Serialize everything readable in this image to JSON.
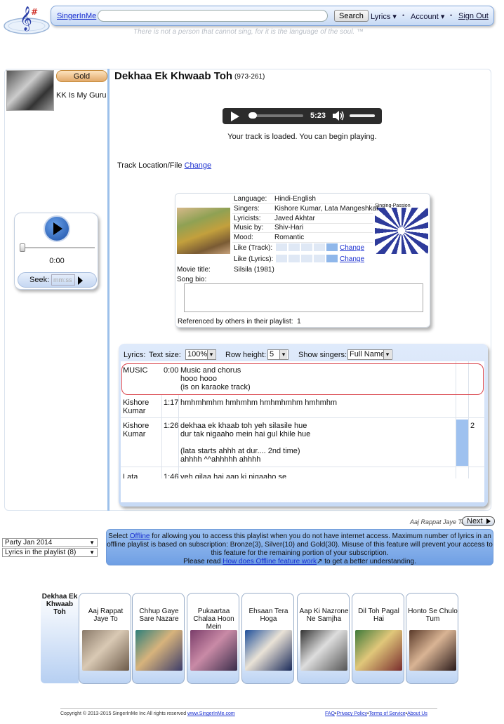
{
  "header": {
    "brand_link": "SingerInMe",
    "search_button": "Search",
    "menu_lyrics": "Lyrics",
    "menu_account": "Account",
    "sign_out": "Sign Out",
    "tagline": "There is not a person that cannot sing, for it is the language of the soul. ™"
  },
  "profile": {
    "badge": "Gold",
    "name": "KK Is My Guru"
  },
  "mini_player": {
    "time": "0:00",
    "seek_label": "Seek:",
    "seek_placeholder": "mm:ss"
  },
  "song": {
    "title": "Dekhaa Ek Khwaab Toh",
    "code": "(973-261)",
    "player_time": "5:23",
    "loaded_message": "Your track is loaded. You can begin playing.",
    "track_location_label": "Track Location/File",
    "track_location_link": "Change"
  },
  "info": {
    "singing_passion_label": "Singing-Passion",
    "fields": [
      {
        "label": "Language:",
        "value": "Hindi-English"
      },
      {
        "label": "Singers:",
        "value": "Kishore Kumar, Lata Mangeshkar"
      },
      {
        "label": "Lyricists:",
        "value": "Javed Akhtar"
      },
      {
        "label": "Music by:",
        "value": "Shiv-Hari"
      },
      {
        "label": "Mood:",
        "value": "Romantic"
      }
    ],
    "like_track_label": "Like (Track):",
    "like_lyrics_label": "Like (Lyrics):",
    "like_change": "Change",
    "like_track_level": 5,
    "like_lyrics_level": 5,
    "movie_title_label": "Movie title:",
    "movie_title_value": "Silsila (1981)",
    "song_bio_label": "Song bio:",
    "referenced_label": "Referenced by others in their playlist:",
    "referenced_count": "1"
  },
  "lyrics_controls": {
    "lyrics_label": "Lyrics:",
    "text_size_label": "Text size:",
    "text_size_value": "100%",
    "row_height_label": "Row height:",
    "row_height_value": "5",
    "show_singers_label": "Show singers:",
    "show_singers_value": "Full Name"
  },
  "lyrics": [
    {
      "singer": "MUSIC",
      "time": "0:00",
      "text": "Music and chorus\nhooo hooo\n(is on karaoke track)"
    },
    {
      "singer": "Kishore\nKumar",
      "time": "1:17",
      "text": "hmhmhmhm hmhmhm hmhmhmhm hmhmhm"
    },
    {
      "singer": "Kishore\nKumar",
      "time": "1:26",
      "text": "dekhaa ek khaab toh yeh silasile hue\ndur tak nigaaho mein hai gul khile hue\n\n(lata starts ahhh at dur.... 2nd time)\nahhhh ^^ahhhhh ahhhh",
      "count": "2"
    },
    {
      "singer": "Lata",
      "time": "1:46",
      "text": "yeh gilaa hai aap ki nigaaho se"
    }
  ],
  "navigation": {
    "next_song": "Aaj Rappat Jaye To",
    "next_button": "Next"
  },
  "playlist": {
    "select_playlist": "Party Jan 2014",
    "select_lyrics": "Lyrics in the playlist (8)",
    "offline_line1_pre": "Select",
    "offline_link": "Offline",
    "offline_line1_post": "for allowing you to access this playlist when you do not have internet access. Maximum number of lyrics in an offline playlist is based on subscription: Bronze(3), Silver(10) and Gold(30). Misuse of this feature will prevent your access to this feature for the remaining portion of your subscription.",
    "offline_line2_pre": "Please read",
    "offline_help_link": "How does Offline feature work",
    "offline_line2_post": "to get a better understanding.",
    "current": "Dekhaa Ek Khwaab Toh",
    "items": [
      {
        "title": "Aaj Rappat Jaye To"
      },
      {
        "title": "Chhup Gaye Sare Nazare"
      },
      {
        "title": "Pukaartaa Chalaa Hoon Mein"
      },
      {
        "title": "Ehsaan Tera Hoga"
      },
      {
        "title": "Aap Ki Nazrone Ne Samjha"
      },
      {
        "title": "Dil Toh Pagal Hai"
      },
      {
        "title": "Honto Se Chulo Tum"
      }
    ]
  },
  "footer": {
    "copyright": "Copyright © 2013-2015 SingerInMe Inc All rights reserved",
    "site_link": "www.SingerInMe.com",
    "faq": "FAQ",
    "privacy": "Privacy Policy",
    "terms": "Terms of Service",
    "about": "About Us"
  },
  "colors": {
    "accent_blue": "#9cc0ea",
    "gold_badge": "#e2a96a",
    "music_row_border": "#d9444c"
  }
}
